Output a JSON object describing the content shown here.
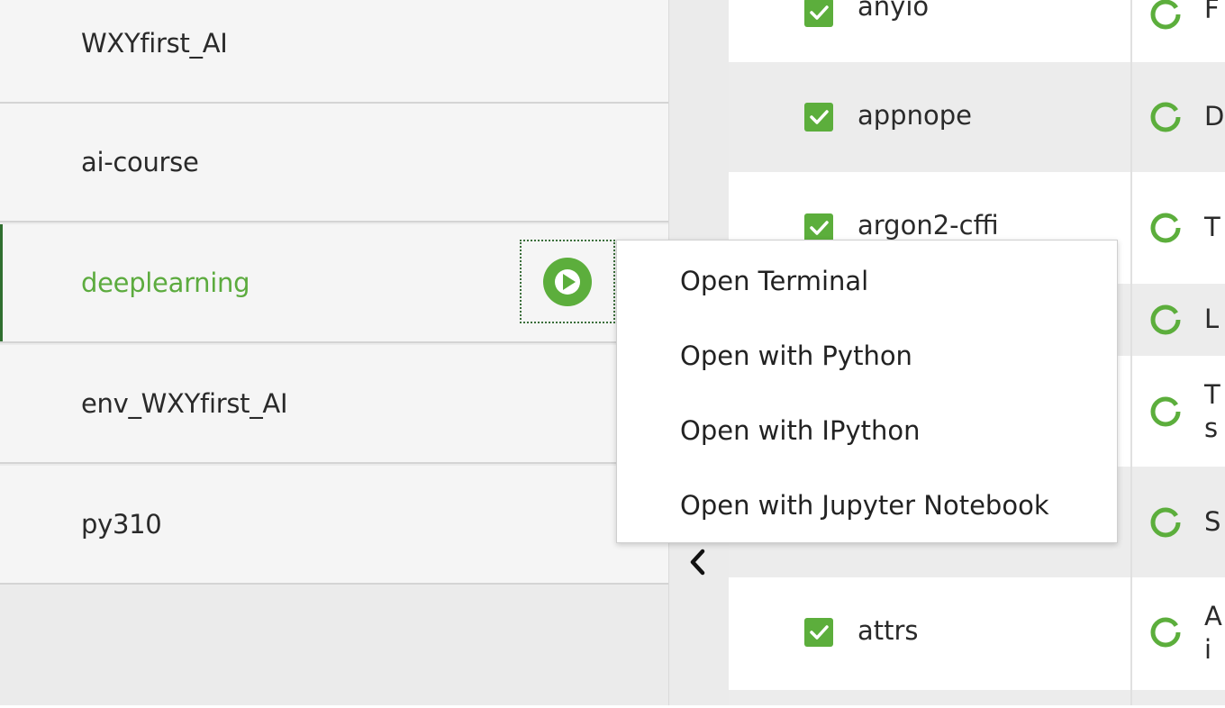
{
  "environments": {
    "items": [
      {
        "label": "WXYfirst_AI",
        "active": false
      },
      {
        "label": "ai-course",
        "active": false
      },
      {
        "label": "deeplearning",
        "active": true
      },
      {
        "label": "env_WXYfirst_AI",
        "active": false
      },
      {
        "label": "py310",
        "active": false
      }
    ],
    "active_color": "#5cab3e",
    "play_icon": "play-circle-icon"
  },
  "context_menu": {
    "items": [
      "Open Terminal",
      "Open with Python",
      "Open with IPython",
      "Open with Jupyter Notebook"
    ]
  },
  "packages": {
    "rows": [
      {
        "name": "anyio",
        "checked": true,
        "desc": [
          "F"
        ]
      },
      {
        "name": "appnope",
        "checked": true,
        "desc": [
          "D"
        ]
      },
      {
        "name": "argon2-cffi",
        "checked": true,
        "desc": [
          "T"
        ]
      },
      {
        "name": "",
        "checked": false,
        "desc": [
          "L"
        ]
      },
      {
        "name": "",
        "checked": false,
        "desc": [
          "T",
          "s"
        ]
      },
      {
        "name": "",
        "checked": false,
        "desc": [
          "S"
        ]
      },
      {
        "name": "attrs",
        "checked": true,
        "desc": [
          "A",
          "i"
        ]
      }
    ],
    "accent_color": "#5cae3c",
    "status_icon": "loading-ring-icon"
  },
  "splitter": {
    "collapse_icon": "chevron-left-icon"
  }
}
